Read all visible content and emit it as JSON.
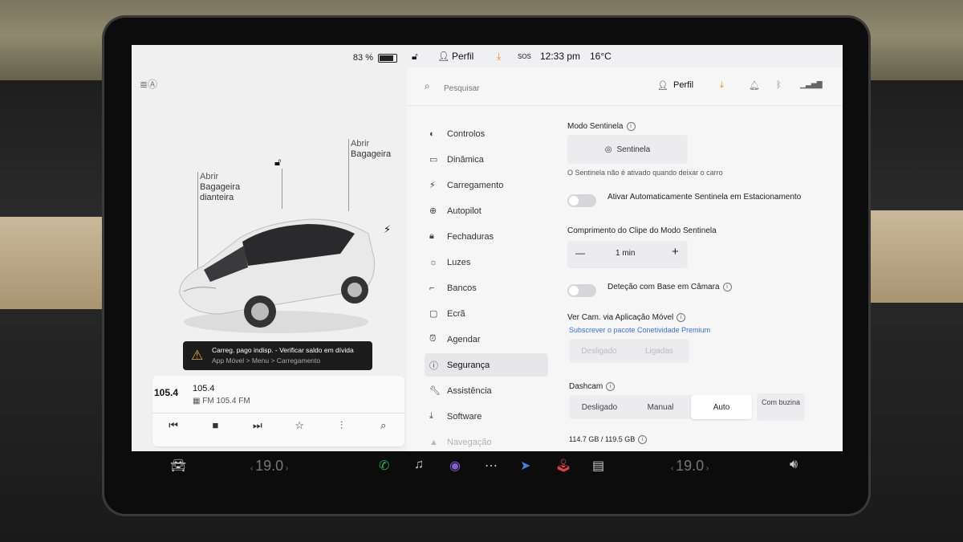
{
  "left": {
    "battery_pct": "83 %",
    "front_trunk": [
      "Abrir",
      "Bagageira",
      "dianteira"
    ],
    "rear_trunk": [
      "Abrir",
      "Bagageira"
    ],
    "warning": {
      "line1": "Carreg. pago indisp. - Verificar saldo em dívida",
      "line2": "App Móvel > Menu > Carregamento"
    },
    "media": {
      "logo": "105.4",
      "frequency": "105.4",
      "station": "FM 105.4 FM"
    }
  },
  "topbar": {
    "profile": "Perfil",
    "sos": "SOS",
    "time": "12:33 pm",
    "temperature": "16°C"
  },
  "search": {
    "placeholder": "Pesquisar"
  },
  "header_profile": "Perfil",
  "menu": [
    {
      "label": "Controlos",
      "icon": "toggle-icon"
    },
    {
      "label": "Dinâmica",
      "icon": "car-icon"
    },
    {
      "label": "Carregamento",
      "icon": "bolt-icon"
    },
    {
      "label": "Autopilot",
      "icon": "steering-wheel-icon"
    },
    {
      "label": "Fechaduras",
      "icon": "lock-icon"
    },
    {
      "label": "Luzes",
      "icon": "light-icon"
    },
    {
      "label": "Bancos",
      "icon": "seat-icon"
    },
    {
      "label": "Ecrã",
      "icon": "screen-icon"
    },
    {
      "label": "Agendar",
      "icon": "alarm-icon"
    },
    {
      "label": "Segurança",
      "icon": "info-icon",
      "active": true
    },
    {
      "label": "Assistência",
      "icon": "wrench-icon"
    },
    {
      "label": "Software",
      "icon": "download-icon"
    },
    {
      "label": "Navegação",
      "icon": "navigation-icon"
    }
  ],
  "security": {
    "sentry_title": "Modo Sentinela",
    "sentry_button": "Sentinela",
    "sentry_note": "O Sentinela não é ativado quando deixar o carro",
    "auto_sentry": "Ativar Automaticamente Sentinela em Estacionamento",
    "clip_title": "Comprimento do Clipe do Modo Sentinela",
    "clip_minus": "—",
    "clip_value": "1 min",
    "clip_plus": "+",
    "camera_detection": "Deteção com Base em Câmara",
    "view_cam_title": "Ver Cam. via Aplicação Móvel",
    "premium_link": "Subscrever o pacote Conetividade Premium",
    "view_cam_off": "Desligado",
    "view_cam_on": "Ligadas",
    "dashcam_title": "Dashcam",
    "dashcam_off": "Desligado",
    "dashcam_manual": "Manual",
    "dashcam_auto": "Auto",
    "dashcam_horn": "Com buzina",
    "storage": "114.7 GB / 119.5 GB"
  },
  "dock": {
    "temp_left": "19.0",
    "temp_right": "19.0"
  },
  "colors": {
    "accent_orange": "#e8892a",
    "link_blue": "#3b6fd9",
    "phone_green": "#2ab04a"
  }
}
